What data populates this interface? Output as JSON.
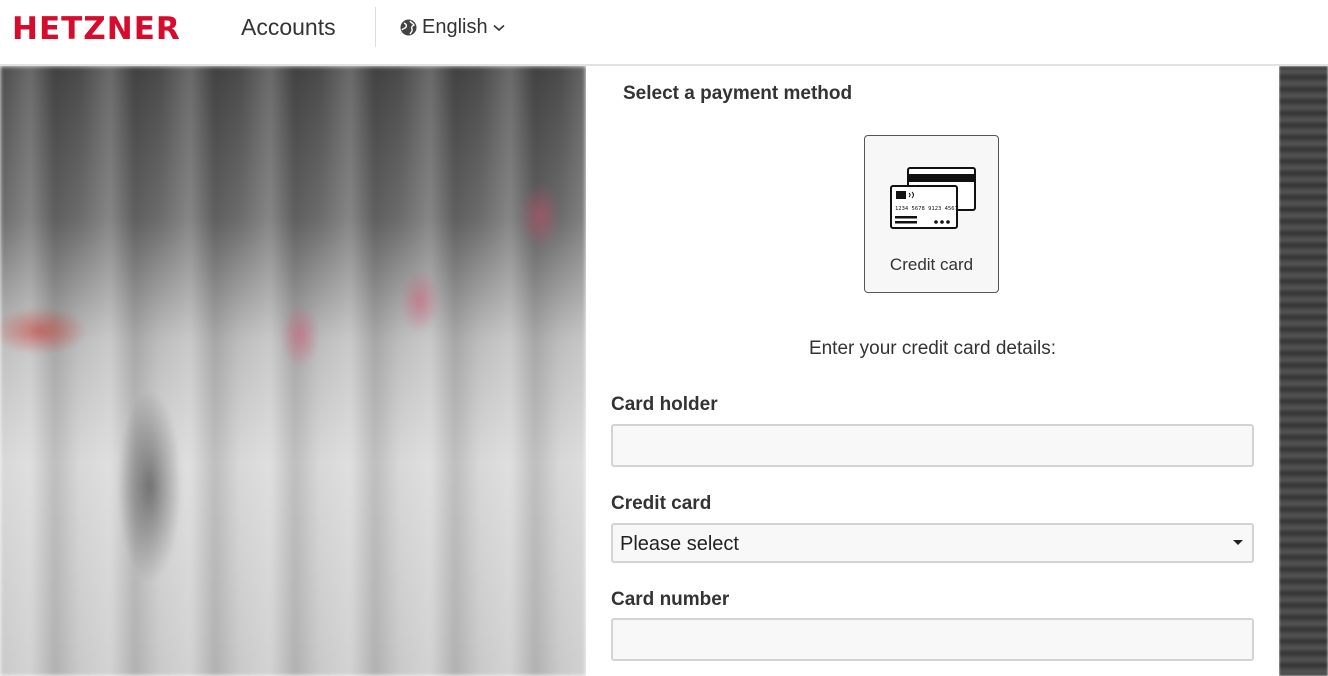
{
  "header": {
    "logo_text": "HETZNER",
    "app_name": "Accounts",
    "language": "English"
  },
  "payment": {
    "section_title": "Select a payment method",
    "method_label": "Credit card",
    "instructions": "Enter your credit card details:"
  },
  "form": {
    "card_holder": {
      "label": "Card holder",
      "value": ""
    },
    "credit_card": {
      "label": "Credit card",
      "selected": "Please select"
    },
    "card_number": {
      "label": "Card number",
      "value": ""
    }
  },
  "icons": {
    "language": "globe-icon",
    "dropdown": "chevron-down-icon",
    "payment": "credit-card-icon"
  },
  "colors": {
    "brand": "#d50c2d",
    "text": "#333333",
    "input_border": "#d3d3d3"
  }
}
